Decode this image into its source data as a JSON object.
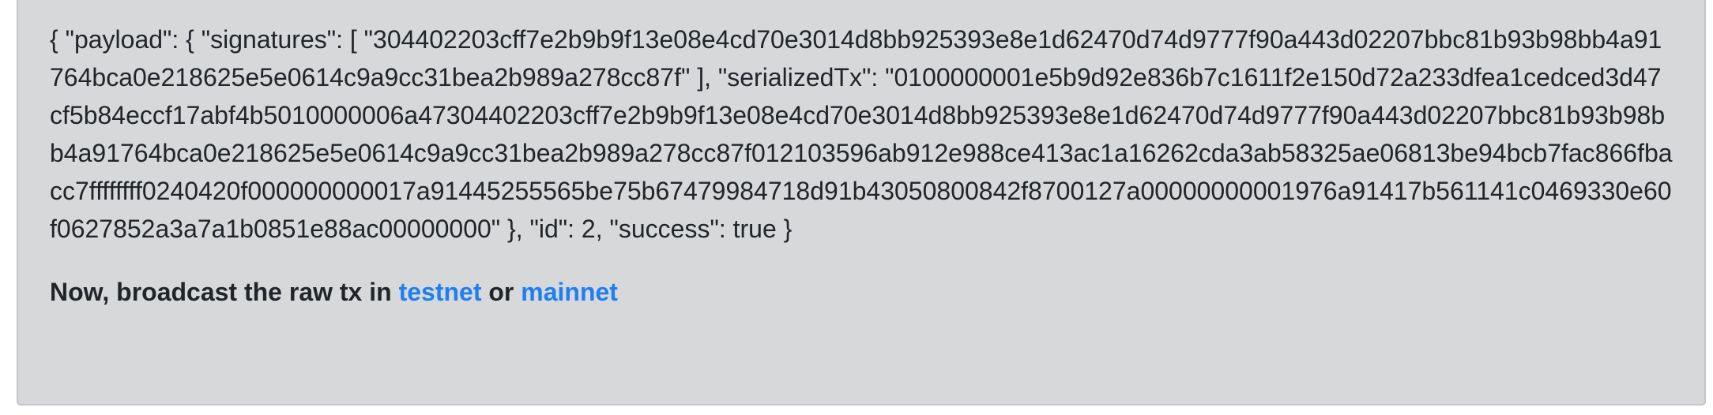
{
  "response": {
    "json_text": "{ \"payload\": { \"signatures\": [ \"304402203cff7e2b9b9f13e08e4cd70e3014d8bb925393e8e1d62470d74d9777f90a443d02207bbc81b93b98bb4a91764bca0e218625e5e0614c9a9cc31bea2b989a278cc87f\" ], \"serializedTx\": \"0100000001e5b9d92e836b7c1611f2e150d72a233dfea1cedced3d47cf5b84eccf17abf4b5010000006a47304402203cff7e2b9b9f13e08e4cd70e3014d8bb925393e8e1d62470d74d9777f90a443d02207bbc81b93b98bb4a91764bca0e218625e5e0614c9a9cc31bea2b989a278cc87f012103596ab912e988ce413ac1a16262cda3ab58325ae06813be94bcb7fac866fbacc7ffffffff0240420f000000000017a91445255565be75b67479984718d91b43050800842f8700127a00000000001976a91417b561141c0469330e60f0627852a3a7a1b0851e88ac00000000\" }, \"id\": 2, \"success\": true }"
  },
  "broadcast": {
    "prefix": "Now, broadcast the raw tx in ",
    "testnet_label": "testnet",
    "separator": " or ",
    "mainnet_label": "mainnet"
  },
  "colors": {
    "panel_background": "#d7d8da",
    "link": "#1f7ff0",
    "text": "#212529"
  }
}
